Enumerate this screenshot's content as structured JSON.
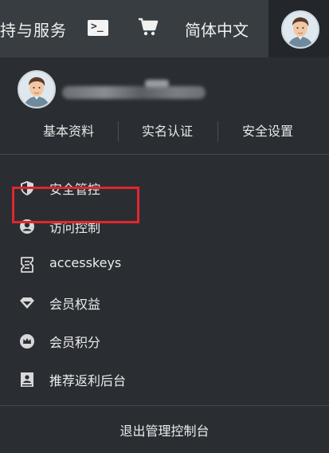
{
  "topbar": {
    "partial_text": "持与服务",
    "terminal_icon_glyph": ">_",
    "language": "简体中文"
  },
  "user_tabs": [
    {
      "label": "基本资料"
    },
    {
      "label": "实名认证"
    },
    {
      "label": "安全设置"
    }
  ],
  "menu": [
    {
      "label": "安全管控",
      "icon": "shield-icon"
    },
    {
      "label": "访问控制",
      "icon": "user-circle-icon"
    },
    {
      "label": "accesskeys",
      "icon": "key-document-icon"
    },
    {
      "label": "会员权益",
      "icon": "diamond-icon"
    },
    {
      "label": "会员积分",
      "icon": "crown-circle-icon"
    },
    {
      "label": "推荐返利后台",
      "icon": "referral-icon"
    }
  ],
  "logout_label": "退出管理控制台",
  "colors": {
    "topbar_bg": "#373d41",
    "panel_bg": "#2a2e33",
    "highlight": "#e3252c"
  }
}
